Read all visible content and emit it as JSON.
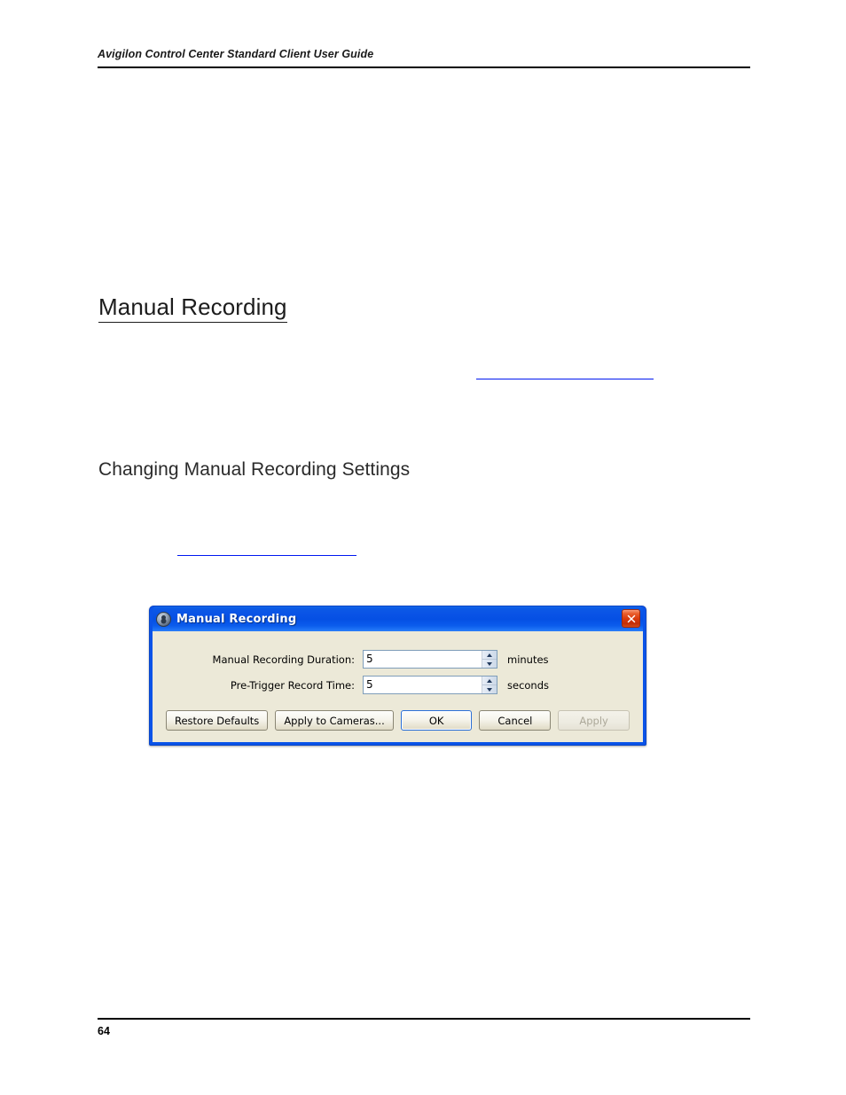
{
  "document": {
    "running_header": "Avigilon Control Center Standard Client User Guide",
    "heading_1": "Manual Recording",
    "heading_2": "Changing Manual Recording Settings",
    "page_number": "64",
    "cross_reference_1": "",
    "cross_reference_2": "",
    "link_color": "#0018f0",
    "rule_color": "#000000"
  },
  "dialog": {
    "title": "Manual Recording",
    "title_icon": "clock-icon",
    "close_icon": "close-icon",
    "titlebar_color": "#0a53e6",
    "body_color": "#ece9d8",
    "fields": [
      {
        "label": "Manual Recording Duration:",
        "value": "5",
        "unit": "minutes",
        "spinner_up_icon": "triangle-up-icon",
        "spinner_down_icon": "triangle-down-icon"
      },
      {
        "label": "Pre-Trigger Record Time:",
        "value": "5",
        "unit": "seconds",
        "spinner_up_icon": "triangle-up-icon",
        "spinner_down_icon": "triangle-down-icon"
      }
    ],
    "buttons": {
      "restore_defaults": "Restore Defaults",
      "apply_to_cameras": "Apply to Cameras...",
      "ok": "OK",
      "cancel": "Cancel",
      "apply": "Apply"
    }
  }
}
